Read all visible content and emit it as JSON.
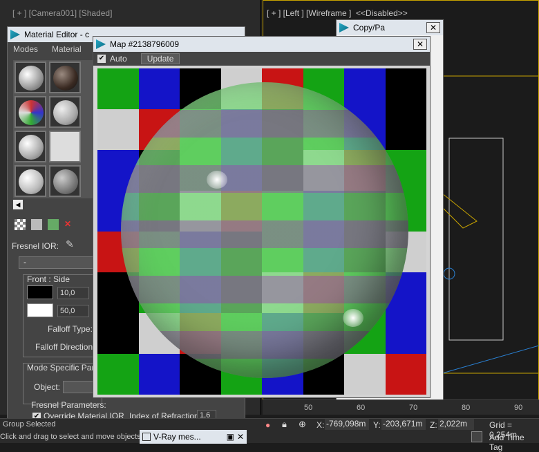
{
  "viewports": {
    "camera_label": "[ + ] [Camera001] [Shaded]",
    "left_label": "[ + ] [Left ] [Wireframe ]  <<Disabled>>"
  },
  "material_editor": {
    "title": "Material Editor - c",
    "menu": [
      "Modes",
      "Material"
    ],
    "fresnel_ior_label": "Fresnel IOR:",
    "rollout_label": "-",
    "front_side_label": "Front : Side",
    "value1": "10,0",
    "value2": "50,0",
    "falloff_type_label": "Falloff Type:",
    "falloff_direction_label": "Falloff Direction:",
    "mode_specific_label": "Mode Specific Para",
    "object_label": "Object:",
    "fresnel_params_label": "Fresnel Parameters:",
    "override_label": "Override Material IOR",
    "ior_label": "Index of Refraction",
    "ior_value": "1,6"
  },
  "copy_window": {
    "title": "Copy/Pa"
  },
  "map_window": {
    "title": "Map #2138796009",
    "auto_label": "Auto",
    "auto_checked": true,
    "update_label": "Update"
  },
  "ruler": [
    "50",
    "60",
    "70",
    "80",
    "90"
  ],
  "status": {
    "selection": "Group Selected",
    "prompt": "Click and drag to select and move objects",
    "vray_task": "V-Ray mes...",
    "x_label": "X:",
    "x_value": "-769,098m",
    "y_label": "Y:",
    "y_value": "-203,671m",
    "z_label": "Z:",
    "z_value": "2,022m",
    "grid": "Grid = 0,254m",
    "add_time_tag": "Add Time Tag"
  },
  "colors": {
    "accent": "#0b6b84",
    "viewport_border": "#c9a400",
    "wire": "#2a7fd0"
  }
}
